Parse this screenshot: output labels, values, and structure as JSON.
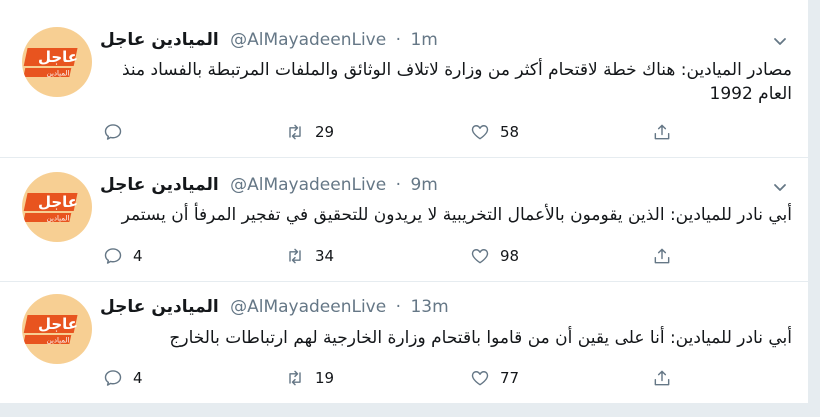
{
  "tweets": [
    {
      "name": "الميادين عاجل",
      "handle": "@AlMayadeenLive",
      "separator": "·",
      "time": "1m",
      "text": "مصادر الميادين: هناك خطة لاقتحام أكثر من وزارة لاتلاف الوثائق والملفات المرتبطة بالفساد منذ العام 1992",
      "replies": "",
      "retweets": "29",
      "likes": "58"
    },
    {
      "name": "الميادين عاجل",
      "handle": "@AlMayadeenLive",
      "separator": "·",
      "time": "9m",
      "text": "أبي نادر للميادين: الذين يقومون بالأعمال التخريبية لا يريدون للتحقيق في تفجير المرفأ أن يستمر",
      "replies": "4",
      "retweets": "34",
      "likes": "98"
    },
    {
      "name": "الميادين عاجل",
      "handle": "@AlMayadeenLive",
      "separator": "·",
      "time": "13m",
      "text": "أبي نادر للميادين: أنا على يقين أن من قاموا باقتحام وزارة الخارجية لهم ارتباطات بالخارج",
      "replies": "4",
      "retweets": "19",
      "likes": "77"
    }
  ],
  "avatar": {
    "logo_text": "عاجل",
    "sub_text": "الميادين"
  },
  "icons": {
    "reply": "reply-icon",
    "retweet": "retweet-icon",
    "like": "heart-icon",
    "share": "share-icon",
    "caret": "chevron-down-icon"
  },
  "colors": {
    "accent_orange": "#e8541f",
    "avatar_bg": "#f7cf93",
    "muted": "#657786"
  }
}
